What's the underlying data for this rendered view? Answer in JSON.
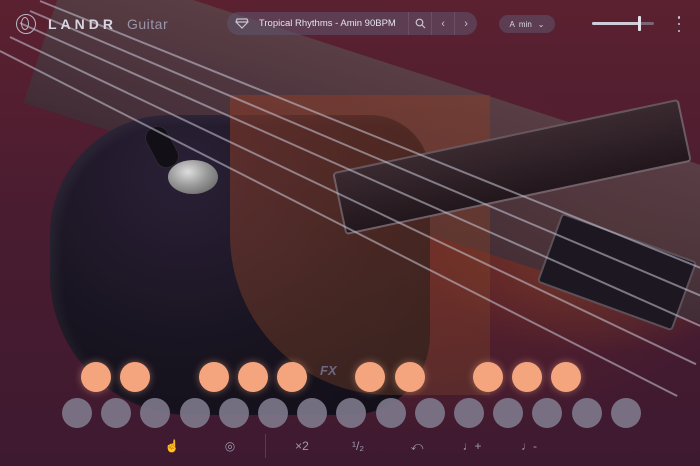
{
  "app": {
    "brand": "LANDR",
    "product": "Guitar"
  },
  "preset": {
    "name": "Tropical Rhythms - Amin 90BPM",
    "icon": "preset-gem-icon",
    "search_icon": "search-icon",
    "prev_icon": "chevron-left-icon",
    "next_icon": "chevron-right-icon"
  },
  "key": {
    "value": "A  min",
    "icon": "chevron-down-icon"
  },
  "volume": {
    "level": 0.75
  },
  "menu_icon": "more-vertical-icon",
  "pads": {
    "fx_label": "FX",
    "top_row_active": [
      true,
      true,
      false,
      true,
      true,
      true,
      false,
      true,
      true,
      false,
      true,
      true,
      true
    ],
    "bottom_row_count": 15,
    "colors": {
      "active": "#f5a57e",
      "inactive": "#7d768a"
    }
  },
  "toolbar": {
    "items": [
      {
        "name": "touch-icon",
        "label": "☝"
      },
      {
        "name": "headphone-icon",
        "label": "◎"
      },
      {
        "name": "double-speed",
        "label": "×2"
      },
      {
        "name": "half-speed",
        "label": "¹/₂"
      },
      {
        "name": "undo-icon",
        "label": "⤺"
      },
      {
        "name": "note-up-icon",
        "label": "♩+"
      },
      {
        "name": "note-down-icon",
        "label": "♩-"
      }
    ]
  },
  "colors": {
    "accent": "#f5a57e",
    "text": "#e7e4ee"
  }
}
